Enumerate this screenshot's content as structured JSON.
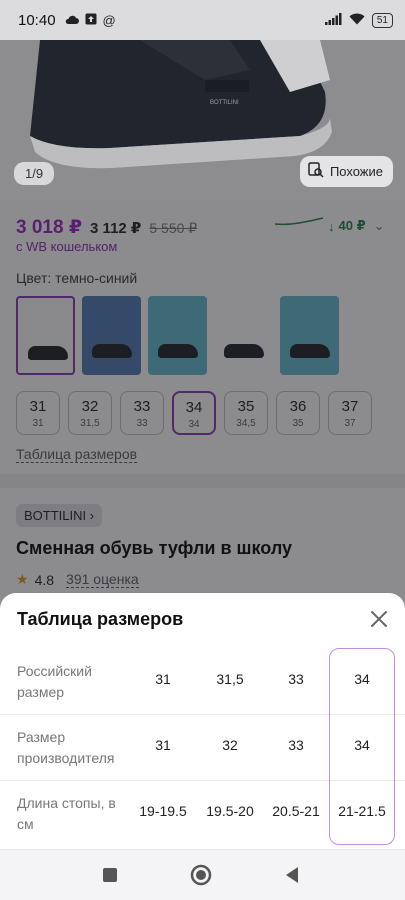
{
  "status_bar": {
    "time": "10:40",
    "battery": "51"
  },
  "gallery": {
    "counter": "1/9",
    "similar_label": "Похожие"
  },
  "product": {
    "price": "3 018 ₽",
    "wallet_price": "3 112 ₽",
    "old_price": "5 550 ₽",
    "wallet_note": "с WB кошельком",
    "price_drop": "40 ₽",
    "color_label": "Цвет:",
    "color_value": "темно-синий",
    "sizes": [
      {
        "size": "31",
        "ru": "31"
      },
      {
        "size": "32",
        "ru": "31,5"
      },
      {
        "size": "33",
        "ru": "33"
      },
      {
        "size": "34",
        "ru": "34"
      },
      {
        "size": "35",
        "ru": "34,5"
      },
      {
        "size": "36",
        "ru": "35"
      },
      {
        "size": "37",
        "ru": "37"
      }
    ],
    "selected_size": "34",
    "size_table_link": "Таблица размеров",
    "brand": "BOTTILINI",
    "title": "Сменная обувь туфли в школу",
    "rating": "4.8",
    "reviews": "391 оценка"
  },
  "size_sheet": {
    "title": "Таблица размеров",
    "rows": [
      {
        "label": "Российский размер",
        "values": [
          "31",
          "31,5",
          "33",
          "34"
        ]
      },
      {
        "label": "Размер производителя",
        "values": [
          "31",
          "32",
          "33",
          "34"
        ]
      },
      {
        "label": "Длина стопы, в см",
        "values": [
          "19-19.5",
          "19.5-20",
          "20.5-21",
          "21-21.5"
        ]
      }
    ],
    "highlighted_column": 3
  },
  "icons": [
    "cloud-icon",
    "upload-icon",
    "at-icon",
    "signal-icon",
    "wifi-icon",
    "search-image-icon",
    "close-icon",
    "star-icon",
    "chevron-right-icon",
    "arrow-down-icon",
    "nav-recents-icon",
    "nav-home-icon",
    "nav-back-icon"
  ],
  "colors": {
    "accent": "#cb11ab",
    "highlight_border": "#c48fe0",
    "price_drop": "#1b9c57"
  }
}
